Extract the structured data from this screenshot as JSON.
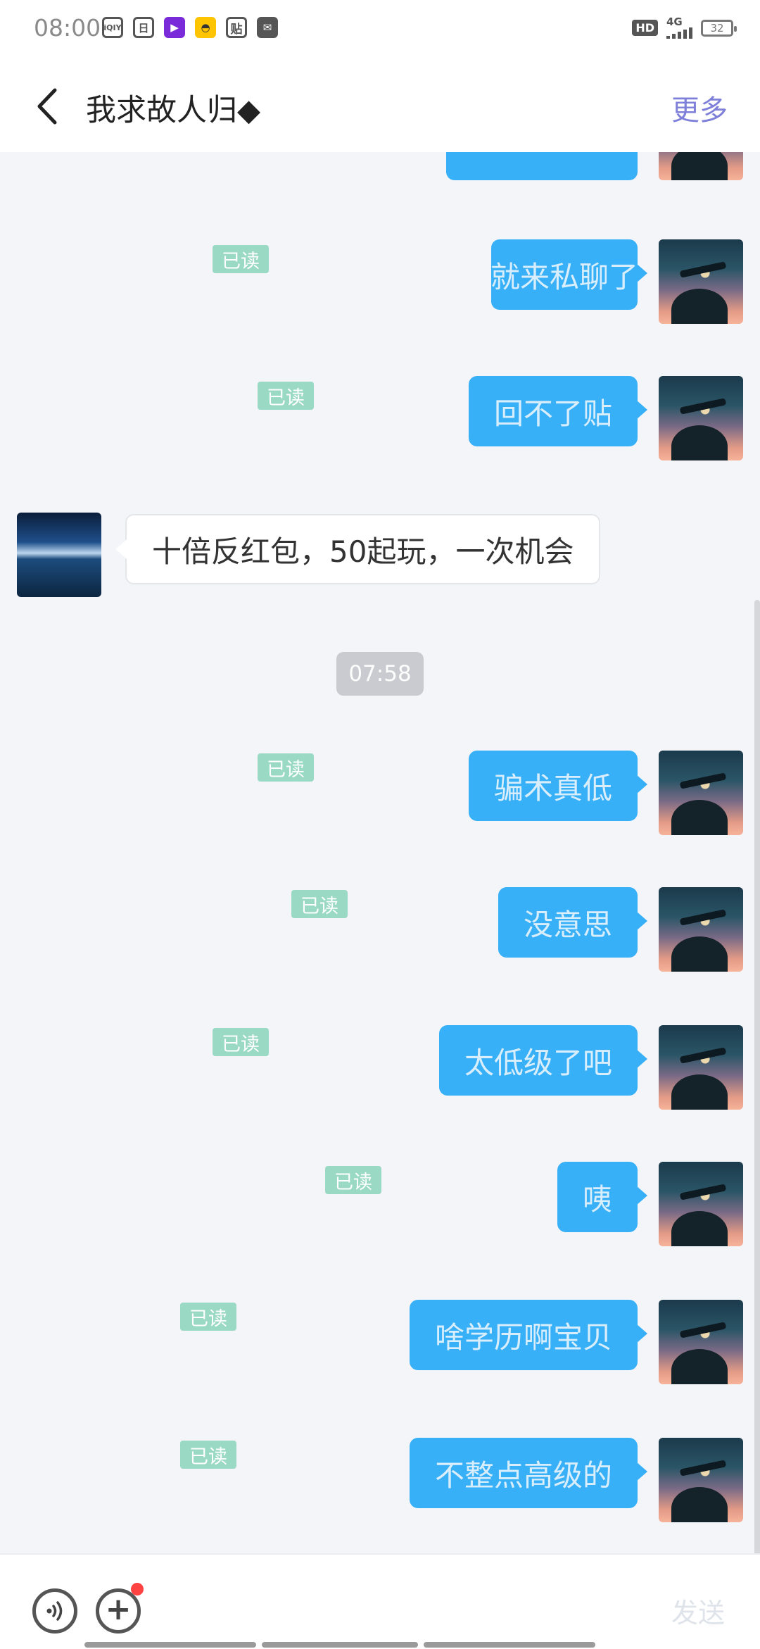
{
  "status_bar": {
    "time": "08:00",
    "app_icons": [
      "iqiyi-icon",
      "calendar-icon",
      "video-icon",
      "car-icon",
      "tieba-icon",
      "message-icon"
    ],
    "app_icon_glyphs": [
      "iQIY",
      "日",
      "▶",
      "◓",
      "贴",
      "✉"
    ],
    "hd": "HD",
    "network": "4G",
    "battery": "32"
  },
  "header": {
    "title": "我求故人归◆",
    "more": "更多"
  },
  "messages": [
    {
      "from": "me",
      "text": "就来私聊了",
      "read": "已读"
    },
    {
      "from": "me",
      "text": "回不了贴",
      "read": "已读"
    },
    {
      "from": "other",
      "text": "十倍反红包，50起玩，一次机会"
    },
    {
      "type": "time",
      "text": "07:58"
    },
    {
      "from": "me",
      "text": "骗术真低",
      "read": "已读"
    },
    {
      "from": "me",
      "text": "没意思",
      "read": "已读"
    },
    {
      "from": "me",
      "text": "太低级了吧",
      "read": "已读"
    },
    {
      "from": "me",
      "text": "咦",
      "read": "已读"
    },
    {
      "from": "me",
      "text": "啥学历啊宝贝",
      "read": "已读"
    },
    {
      "from": "me",
      "text": "不整点高级的",
      "read": "已读"
    }
  ],
  "input": {
    "voice_icon": "voice-icon",
    "plus_icon": "plus-icon",
    "plus_glyph": "+",
    "send": "发送"
  }
}
